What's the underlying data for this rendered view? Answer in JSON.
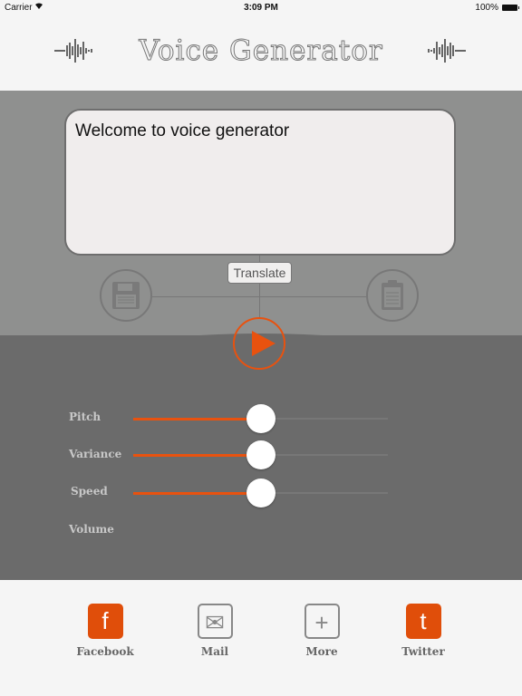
{
  "status_bar": {
    "carrier": "Carrier",
    "time": "3:09 PM",
    "battery": "100%"
  },
  "header": {
    "title": "Voice Generator"
  },
  "text_input": {
    "value": "Welcome to voice generator"
  },
  "controls": {
    "translate_label": "Translate",
    "save_icon": "floppy-disk-icon",
    "clipboard_icon": "clipboard-icon",
    "play_icon": "play-icon"
  },
  "sliders": [
    {
      "label": "Pitch",
      "value": 0.5
    },
    {
      "label": "Variance",
      "value": 0.5
    },
    {
      "label": "Speed",
      "value": 0.5
    },
    {
      "label": "Volume"
    }
  ],
  "share": [
    {
      "label": "Facebook",
      "glyph": "f"
    },
    {
      "label": "Mail",
      "glyph": "✉"
    },
    {
      "label": "More",
      "glyph": "+"
    },
    {
      "label": "Twitter",
      "glyph": "t"
    }
  ],
  "colors": {
    "accent": "#e8520f",
    "panel": "#8f908f",
    "dark_panel": "#6b6b6b"
  }
}
